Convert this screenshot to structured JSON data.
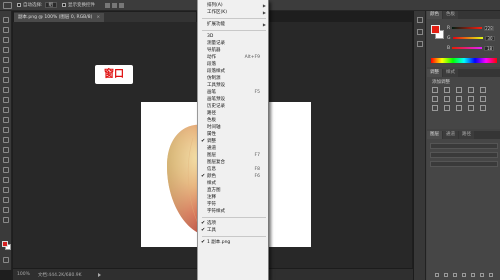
{
  "option_bar": {
    "auto_select_label": "自动选择:",
    "auto_select_value": "组",
    "transform_controls_label": "显示变换控件"
  },
  "document_tab": {
    "title": "副本.png @ 100% (图层 0, RGB/8)",
    "close": "×"
  },
  "callout": {
    "text": "窗口"
  },
  "status_bar": {
    "zoom": "100%",
    "doc_size": "文档:444.2K/680.9K"
  },
  "window_menu": {
    "top_items": [
      {
        "label": "排列(A)",
        "submenu": true
      },
      {
        "label": "工作区(K)",
        "submenu": true
      }
    ],
    "extensions": {
      "label": "扩展功能",
      "submenu": true
    },
    "panels": [
      {
        "label": "3D",
        "checked": false,
        "shortcut": ""
      },
      {
        "label": "测量记录",
        "checked": false,
        "shortcut": ""
      },
      {
        "label": "导航器",
        "checked": false,
        "shortcut": ""
      },
      {
        "label": "动作",
        "checked": false,
        "shortcut": "Alt+F9"
      },
      {
        "label": "段落",
        "checked": false,
        "shortcut": ""
      },
      {
        "label": "段落样式",
        "checked": false,
        "shortcut": ""
      },
      {
        "label": "仿制源",
        "checked": false,
        "shortcut": ""
      },
      {
        "label": "工具预设",
        "checked": false,
        "shortcut": ""
      },
      {
        "label": "画笔",
        "checked": false,
        "shortcut": "F5"
      },
      {
        "label": "画笔预设",
        "checked": false,
        "shortcut": ""
      },
      {
        "label": "历史记录",
        "checked": false,
        "shortcut": ""
      },
      {
        "label": "路径",
        "checked": false,
        "shortcut": ""
      },
      {
        "label": "色板",
        "checked": false,
        "shortcut": ""
      },
      {
        "label": "时间轴",
        "checked": false,
        "shortcut": ""
      },
      {
        "label": "属性",
        "checked": false,
        "shortcut": ""
      },
      {
        "label": "调整",
        "checked": true,
        "shortcut": ""
      },
      {
        "label": "通道",
        "checked": false,
        "shortcut": ""
      },
      {
        "label": "图层",
        "checked": false,
        "shortcut": "F7"
      },
      {
        "label": "图层复合",
        "checked": false,
        "shortcut": ""
      },
      {
        "label": "信息",
        "checked": false,
        "shortcut": "F8"
      },
      {
        "label": "颜色",
        "checked": true,
        "shortcut": "F6"
      },
      {
        "label": "样式",
        "checked": false,
        "shortcut": ""
      },
      {
        "label": "直方图",
        "checked": false,
        "shortcut": ""
      },
      {
        "label": "注释",
        "checked": false,
        "shortcut": ""
      },
      {
        "label": "字符",
        "checked": false,
        "shortcut": ""
      },
      {
        "label": "字符样式",
        "checked": false,
        "shortcut": ""
      }
    ],
    "bottom_items": [
      {
        "label": "选项",
        "checked": true
      },
      {
        "label": "工具",
        "checked": true
      }
    ],
    "open_document": {
      "label": "1 副本.png",
      "checked": true
    }
  },
  "color_panel": {
    "tabs": [
      "颜色",
      "色板"
    ],
    "fg_color": "#e41e12",
    "bg_color": "#ffffff",
    "channels": [
      {
        "name": "R",
        "value": "228"
      },
      {
        "name": "G",
        "value": "30"
      },
      {
        "name": "B",
        "value": "18"
      }
    ]
  },
  "adjust_panel": {
    "tabs": [
      "调整",
      "样式"
    ],
    "title": "添加调整"
  },
  "layers_panel": {
    "tabs": [
      "图层",
      "通道",
      "路径"
    ]
  }
}
